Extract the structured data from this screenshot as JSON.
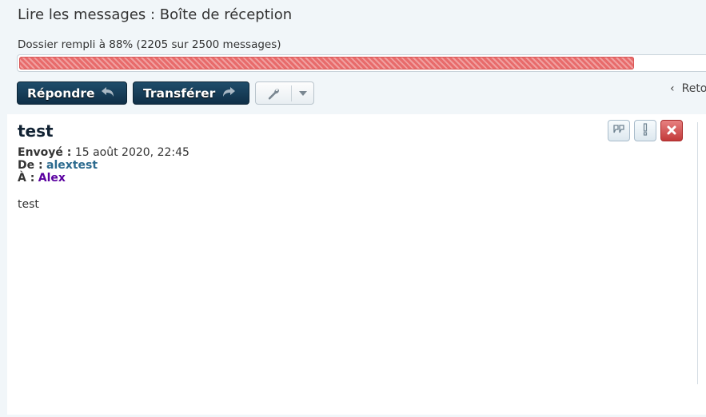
{
  "page": {
    "title": "Lire les messages : Boîte de réception"
  },
  "folder": {
    "status_text": "Dossier rempli à 88% (2205 sur 2500 messages)",
    "fill_percent": 88,
    "fill_color": "#e86b6b"
  },
  "toolbar": {
    "reply_label": "Répondre",
    "forward_label": "Transférer",
    "tools_icon": "wrench-icon",
    "back_label": "Retour"
  },
  "message": {
    "subject": "test",
    "sent_label": "Envoyé :",
    "sent_value": "15 août 2020, 22:45",
    "from_label": "De :",
    "from_value": "alextest",
    "to_label": "À :",
    "to_value": "Alex",
    "body": "test",
    "actions": [
      "quote-icon",
      "report-icon",
      "delete-icon"
    ]
  },
  "colors": {
    "dark_button": "#1f4d6b",
    "from_name": "#2b6a8e",
    "to_name": "#5a00a0",
    "delete_button": "#c23a3a"
  }
}
